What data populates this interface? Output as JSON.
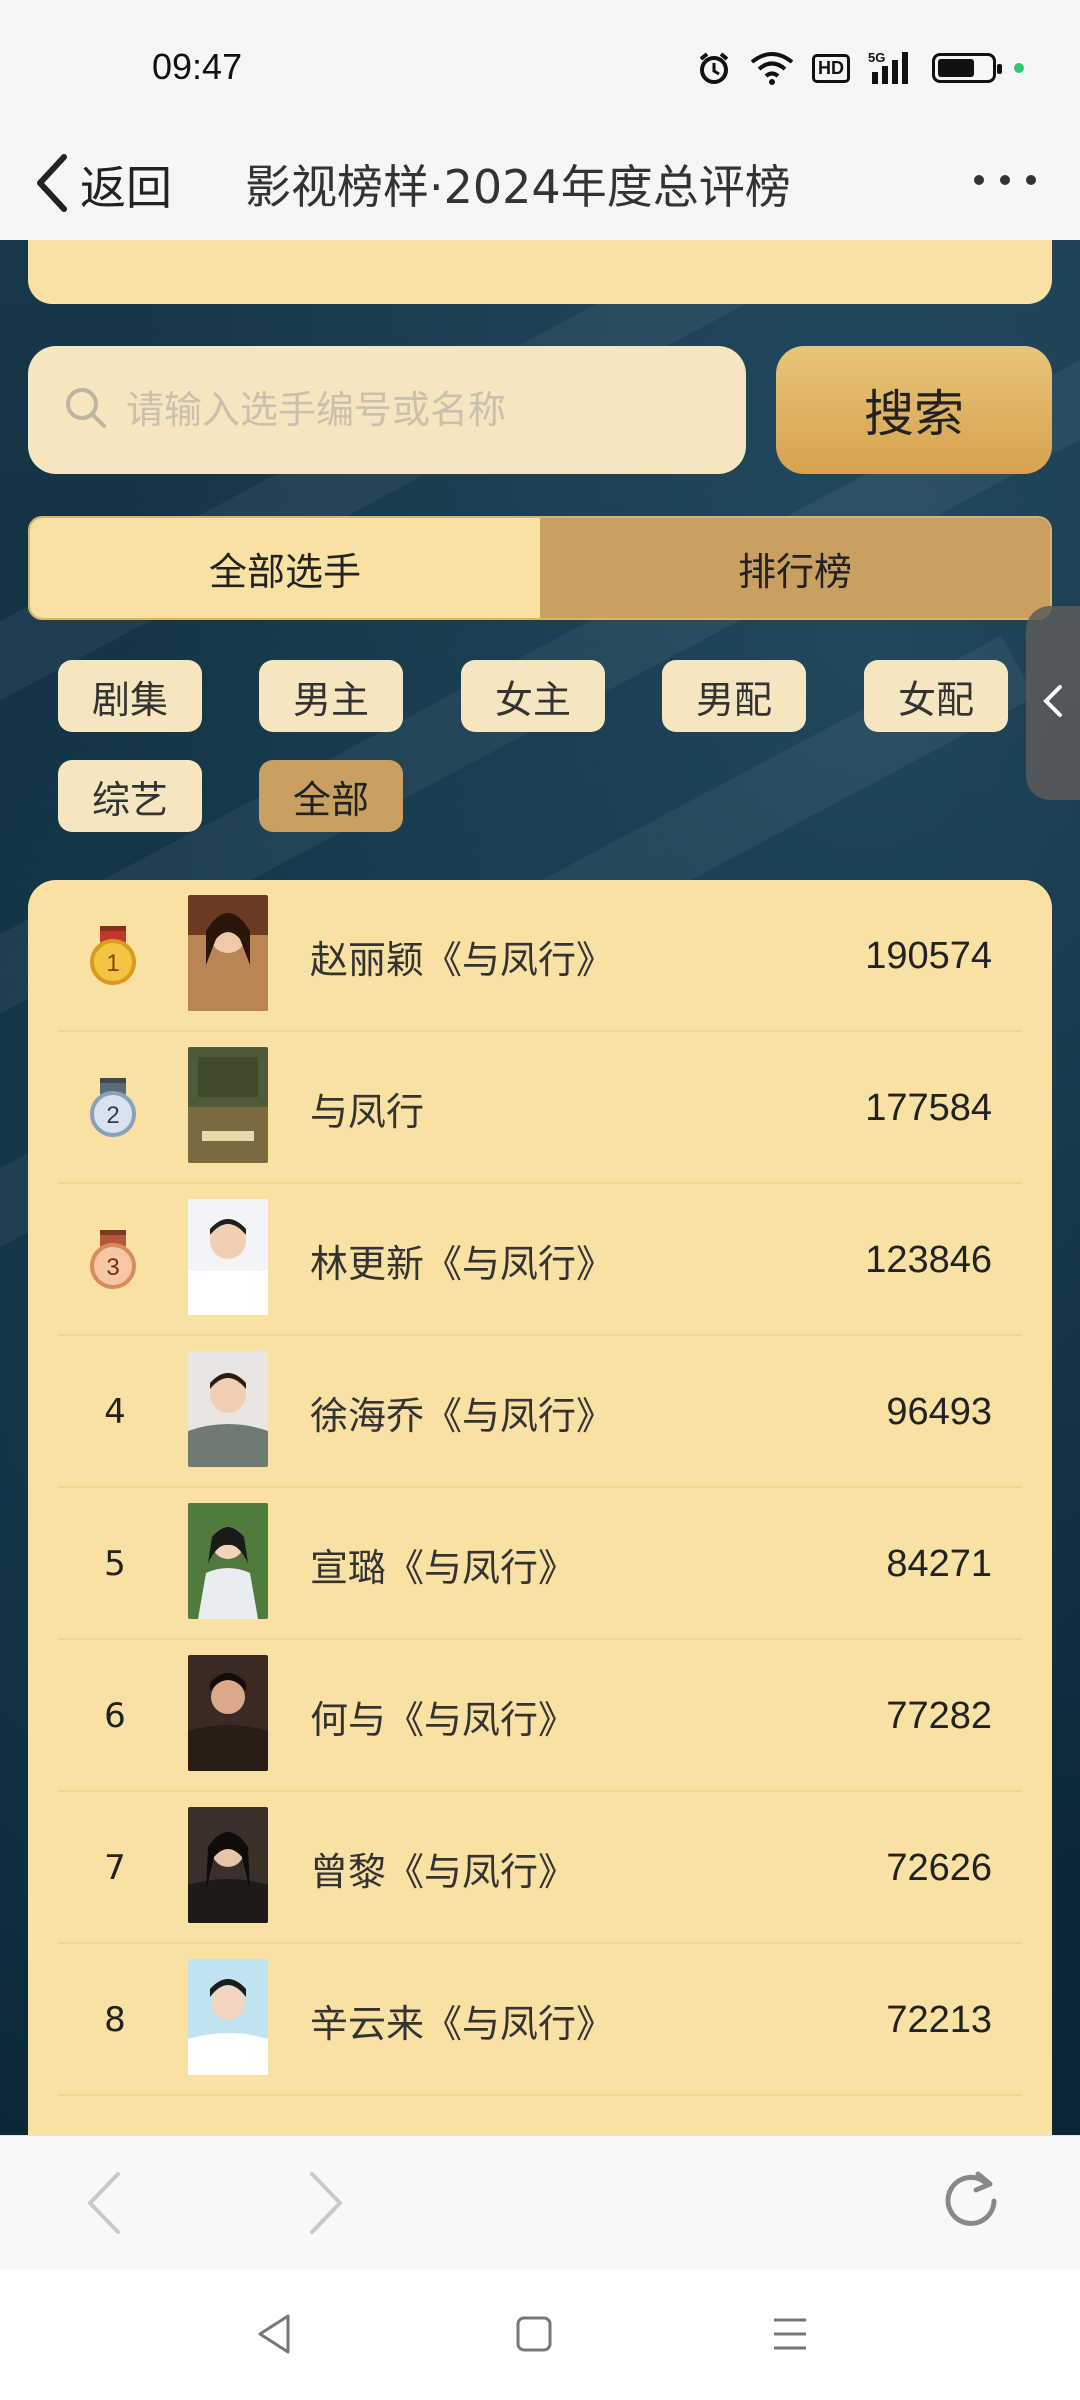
{
  "status_bar": {
    "time": "09:47",
    "hd_label": "HD",
    "network_label": "5G",
    "battery_level": 0.7,
    "icons": [
      "alarm-icon",
      "wifi-icon",
      "hd-icon",
      "signal-5g-icon",
      "battery-icon",
      "green-dot"
    ]
  },
  "nav": {
    "back_label": "返回",
    "title": "影视榜样·2024年度总评榜",
    "icons": [
      "chevron-left-icon",
      "more-icon"
    ]
  },
  "search": {
    "placeholder": "请输入选手编号或名称",
    "value": "",
    "button_label": "搜索"
  },
  "tabs": [
    {
      "label": "全部选手",
      "active": false
    },
    {
      "label": "排行榜",
      "active": true
    }
  ],
  "categories": [
    {
      "label": "剧集",
      "active": false
    },
    {
      "label": "男主",
      "active": false
    },
    {
      "label": "女主",
      "active": false
    },
    {
      "label": "男配",
      "active": false
    },
    {
      "label": "女配",
      "active": false
    },
    {
      "label": "综艺",
      "active": false
    },
    {
      "label": "全部",
      "active": true
    }
  ],
  "ranking": [
    {
      "rank": "1",
      "name": "赵丽颖《与凤行》",
      "score": "190574",
      "medal": "gold"
    },
    {
      "rank": "2",
      "name": "与凤行",
      "score": "177584",
      "medal": "silver"
    },
    {
      "rank": "3",
      "name": "林更新《与凤行》",
      "score": "123846",
      "medal": "bronze"
    },
    {
      "rank": "4",
      "name": "徐海乔《与凤行》",
      "score": "96493",
      "medal": ""
    },
    {
      "rank": "5",
      "name": "宣璐《与凤行》",
      "score": "84271",
      "medal": ""
    },
    {
      "rank": "6",
      "name": "何与《与凤行》",
      "score": "77282",
      "medal": ""
    },
    {
      "rank": "7",
      "name": "曾黎《与凤行》",
      "score": "72626",
      "medal": ""
    },
    {
      "rank": "8",
      "name": "辛云来《与凤行》",
      "score": "72213",
      "medal": ""
    }
  ],
  "colors": {
    "panel": "#f8e1a3",
    "accent": "#c9a060",
    "background": "#0f2f40"
  }
}
